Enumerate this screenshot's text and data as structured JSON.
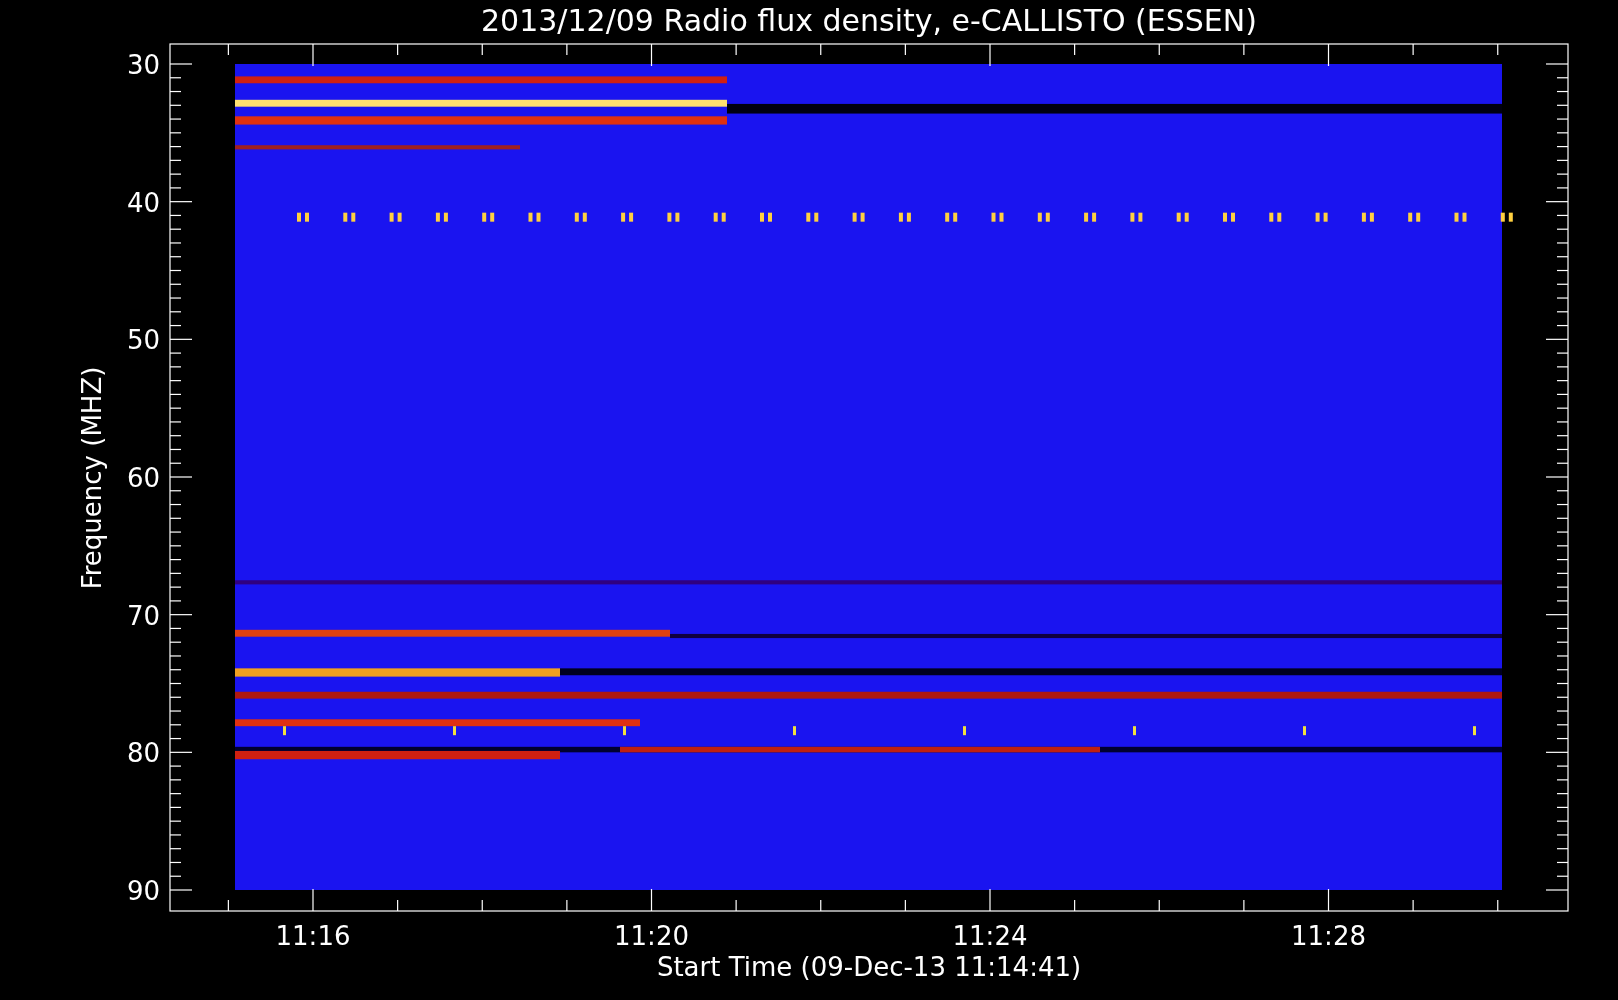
{
  "title": "2013/12/09  Radio flux density, e-CALLISTO (ESSEN)",
  "y_axis": {
    "label": "Frequency (MHZ)",
    "ticks": [
      "30",
      "40",
      "50",
      "60",
      "70",
      "80",
      "90"
    ]
  },
  "x_axis": {
    "label": "Start Time (09-Dec-13 11:14:41)",
    "ticks": [
      "11:16",
      "11:20",
      "11:24",
      "11:28"
    ]
  }
}
